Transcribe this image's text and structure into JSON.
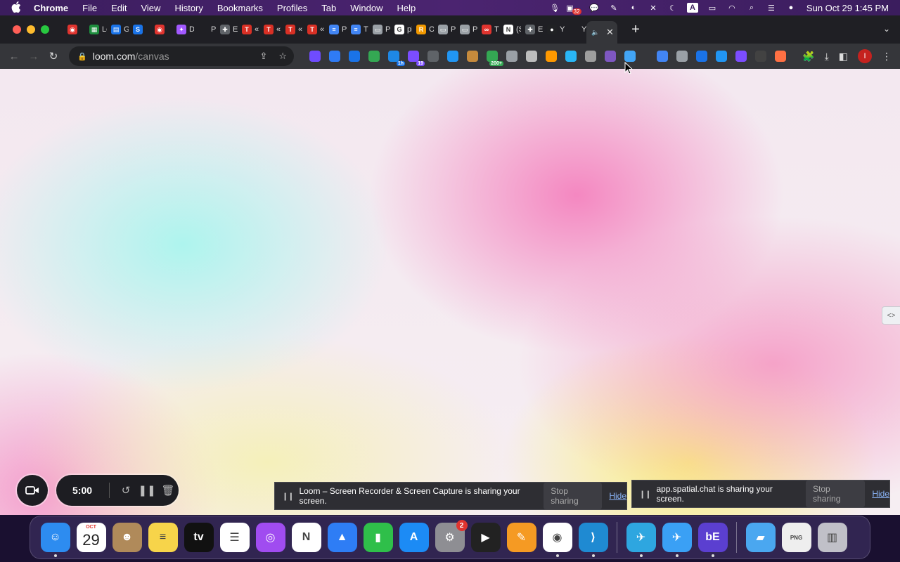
{
  "menubar": {
    "apple_icon": "apple-logo",
    "app_name": "Chrome",
    "items": [
      "File",
      "Edit",
      "View",
      "History",
      "Bookmarks",
      "Profiles",
      "Tab",
      "Window",
      "Help"
    ],
    "notification_count": "32",
    "clock": "Sun Oct 29  1:45 PM"
  },
  "tabs": [
    {
      "label": "",
      "color": "#e0342f",
      "icon": "record-icon"
    },
    {
      "label": "Le",
      "color": "#1e8e3e",
      "icon": "sheets-icon"
    },
    {
      "label": "Gc",
      "color": "#1a73e8",
      "icon": "calendar-icon"
    },
    {
      "label": "",
      "color": "#1a73e8",
      "icon": "s-icon"
    },
    {
      "label": "",
      "color": "#e0342f",
      "icon": "record-icon"
    },
    {
      "label": "De",
      "color": "#a259ff",
      "icon": "figma-icon"
    },
    {
      "label": "Pl",
      "color": "#35363a",
      "icon": "blank-icon"
    },
    {
      "label": "Ex",
      "color": "#5f6368",
      "icon": "puzzle-icon"
    },
    {
      "label": "«",
      "color": "#d93025",
      "icon": "t-icon"
    },
    {
      "label": "«",
      "color": "#d93025",
      "icon": "t-icon"
    },
    {
      "label": "«",
      "color": "#d93025",
      "icon": "t-icon"
    },
    {
      "label": "«",
      "color": "#d93025",
      "icon": "t-icon"
    },
    {
      "label": "Pi",
      "color": "#4285f4",
      "icon": "docs-icon"
    },
    {
      "label": "Ti",
      "color": "#4285f4",
      "icon": "docs-icon"
    },
    {
      "label": "Pa",
      "color": "#9aa0a6",
      "icon": "page-icon"
    },
    {
      "label": "pi",
      "color": "#ffffff",
      "icon": "google-icon"
    },
    {
      "label": "Or",
      "color": "#f29900",
      "icon": "r-icon"
    },
    {
      "label": "Pa",
      "color": "#9aa0a6",
      "icon": "page-icon"
    },
    {
      "label": "Pa",
      "color": "#9aa0a6",
      "icon": "page-icon"
    },
    {
      "label": "Ti",
      "color": "#e0342f",
      "icon": "loop-icon"
    },
    {
      "label": "(S",
      "color": "#ffffff",
      "icon": "notion-icon"
    },
    {
      "label": "Ex",
      "color": "#5f6368",
      "icon": "puzzle-icon"
    },
    {
      "label": "Yc",
      "color": "#202124",
      "icon": "circle-icon"
    },
    {
      "label": "Yc",
      "color": "#35363a",
      "icon": "blank-icon"
    }
  ],
  "active_tab": {
    "icon": "speaker-icon"
  },
  "toolbar": {
    "url_host": "loom.com",
    "url_path": "/canvas",
    "profile_initial": "I",
    "extension_badges": {
      "ext5_badge": "1h",
      "ext7_badge": "19",
      "ext11_badge": "200+"
    }
  },
  "extensions": [
    {
      "name": "ext-flower-icon",
      "color": "#6f4cff"
    },
    {
      "name": "ext-compass-icon",
      "color": "#2f7bf5"
    },
    {
      "name": "ext-calendar-icon",
      "color": "#1a73e8"
    },
    {
      "name": "ext-chrome-icon",
      "color": "#34a853"
    },
    {
      "name": "ext-sync-icon",
      "color": "#1e88e5"
    },
    {
      "name": "ext-shield-icon",
      "color": "#7b4dff"
    },
    {
      "name": "ext-s-icon",
      "color": "#5f6368"
    },
    {
      "name": "ext-picture-icon",
      "color": "#2196f3"
    },
    {
      "name": "ext-cookie-icon",
      "color": "#c68a3c"
    },
    {
      "name": "ext-pie-icon",
      "color": "#34a853"
    },
    {
      "name": "ext-link-icon",
      "color": "#9aa0a6"
    },
    {
      "name": "ext-search-icon",
      "color": "#bdbdbd"
    },
    {
      "name": "ext-amazon-icon",
      "color": "#ff9900"
    },
    {
      "name": "ext-cube-icon",
      "color": "#29b6f6"
    },
    {
      "name": "ext-crx-icon",
      "color": "#9e9e9e"
    },
    {
      "name": "ext-u-icon",
      "color": "#7e57c2"
    },
    {
      "name": "ext-bolt-icon",
      "color": "#42a5f5"
    },
    {
      "name": "ext-translate-icon",
      "color": "#4285f4"
    },
    {
      "name": "ext-doc-search-icon",
      "color": "#9aa0a6"
    },
    {
      "name": "ext-diamond-icon",
      "color": "#1a73e8"
    },
    {
      "name": "ext-wave-icon",
      "color": "#2196f3"
    },
    {
      "name": "ext-screen-icon",
      "color": "#7c4dff"
    },
    {
      "name": "ext-square-icon",
      "color": "#424242"
    },
    {
      "name": "ext-heart-icon",
      "color": "#ff7043"
    }
  ],
  "loom": {
    "timer": "5:00"
  },
  "share_notices": [
    {
      "text": "Loom – Screen Recorder & Screen Capture is sharing your screen.",
      "stop": "Stop sharing",
      "hide": "Hide"
    },
    {
      "text": "app.spatial.chat is sharing your screen.",
      "stop": "Stop sharing",
      "hide": "Hide"
    }
  ],
  "dock": {
    "calendar_month": "OCT",
    "calendar_day": "29",
    "settings_badge": "2",
    "apps": [
      {
        "name": "finder",
        "color": "#2d8cf0"
      },
      {
        "name": "calendar",
        "color": "#ffffff"
      },
      {
        "name": "contacts",
        "color": "#b08a5a"
      },
      {
        "name": "notes",
        "color": "#f7d44a"
      },
      {
        "name": "apple-tv",
        "color": "#111111"
      },
      {
        "name": "reminders",
        "color": "#ffffff"
      },
      {
        "name": "podcasts",
        "color": "#a04cf0"
      },
      {
        "name": "news",
        "color": "#ffffff"
      },
      {
        "name": "keynote",
        "color": "#2e7df5"
      },
      {
        "name": "numbers",
        "color": "#2fbf4a"
      },
      {
        "name": "app-store",
        "color": "#1c8bf5"
      },
      {
        "name": "system-settings",
        "color": "#8e8e93"
      },
      {
        "name": "final-cut",
        "color": "#222222"
      },
      {
        "name": "pages",
        "color": "#f59a23"
      },
      {
        "name": "chrome",
        "color": "#ffffff"
      },
      {
        "name": "vscode",
        "color": "#1f8ad2"
      },
      {
        "name": "telegram",
        "color": "#2ea6e0"
      },
      {
        "name": "testflight",
        "color": "#3aa0f5"
      },
      {
        "name": "be-app",
        "color": "#5b3fd0"
      },
      {
        "name": "downloads-folder",
        "color": "#4aa7f0"
      },
      {
        "name": "png-file",
        "color": "#eeeeee"
      },
      {
        "name": "trash",
        "color": "#c0c0c8"
      }
    ]
  }
}
